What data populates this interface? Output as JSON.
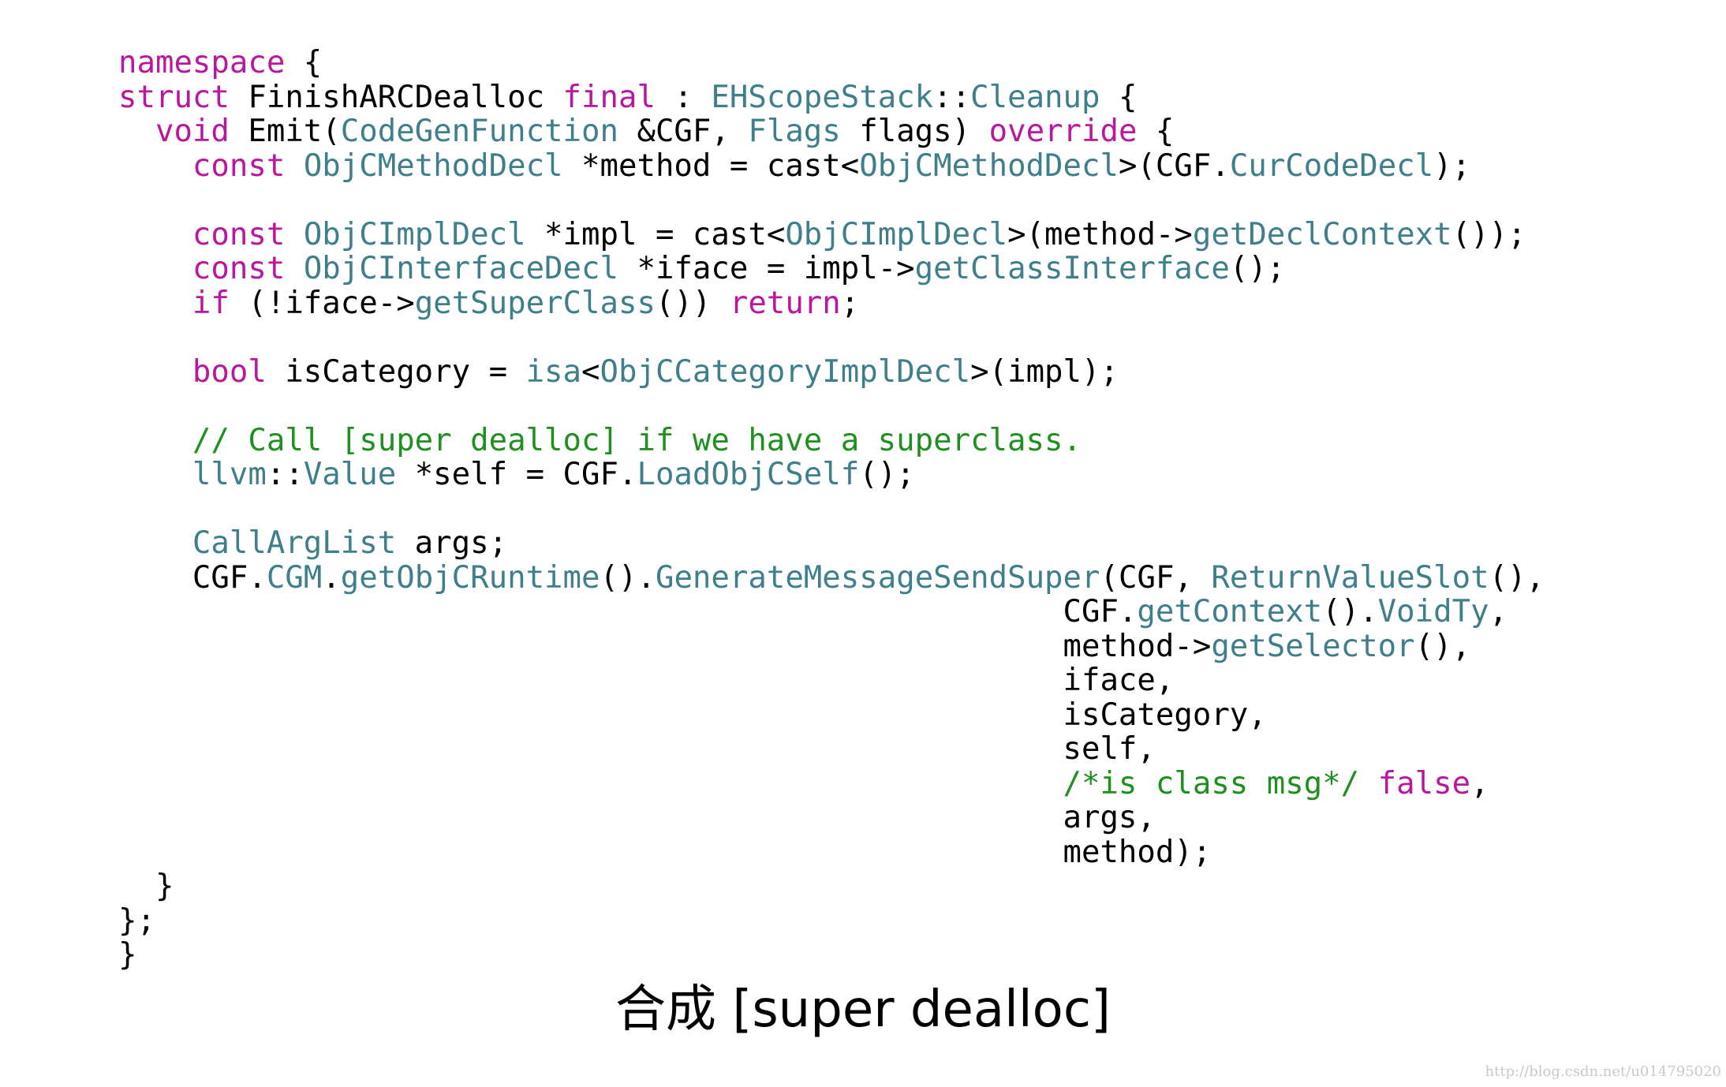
{
  "code_lines": [
    [
      {
        "t": "namespace",
        "c": "kw"
      },
      {
        "t": " {",
        "c": "pl"
      }
    ],
    [
      {
        "t": "struct",
        "c": "kw"
      },
      {
        "t": " FinishARCDealloc ",
        "c": "pl"
      },
      {
        "t": "final",
        "c": "kw"
      },
      {
        "t": " : ",
        "c": "pl"
      },
      {
        "t": "EHScopeStack",
        "c": "ty"
      },
      {
        "t": "::",
        "c": "pl"
      },
      {
        "t": "Cleanup",
        "c": "ty"
      },
      {
        "t": " {",
        "c": "pl"
      }
    ],
    [
      {
        "t": "  ",
        "c": "pl"
      },
      {
        "t": "void",
        "c": "kw"
      },
      {
        "t": " Emit(",
        "c": "pl"
      },
      {
        "t": "CodeGenFunction",
        "c": "ty"
      },
      {
        "t": " &CGF, ",
        "c": "pl"
      },
      {
        "t": "Flags",
        "c": "ty"
      },
      {
        "t": " flags) ",
        "c": "pl"
      },
      {
        "t": "override",
        "c": "kw"
      },
      {
        "t": " {",
        "c": "pl"
      }
    ],
    [
      {
        "t": "    ",
        "c": "pl"
      },
      {
        "t": "const",
        "c": "kw"
      },
      {
        "t": " ",
        "c": "pl"
      },
      {
        "t": "ObjCMethodDecl",
        "c": "ty"
      },
      {
        "t": " *method = cast<",
        "c": "pl"
      },
      {
        "t": "ObjCMethodDecl",
        "c": "ty"
      },
      {
        "t": ">(CGF.",
        "c": "pl"
      },
      {
        "t": "CurCodeDecl",
        "c": "fn"
      },
      {
        "t": ");",
        "c": "pl"
      }
    ],
    [],
    [
      {
        "t": "    ",
        "c": "pl"
      },
      {
        "t": "const",
        "c": "kw"
      },
      {
        "t": " ",
        "c": "pl"
      },
      {
        "t": "ObjCImplDecl",
        "c": "ty"
      },
      {
        "t": " *impl = cast<",
        "c": "pl"
      },
      {
        "t": "ObjCImplDecl",
        "c": "ty"
      },
      {
        "t": ">(method->",
        "c": "pl"
      },
      {
        "t": "getDeclContext",
        "c": "fn"
      },
      {
        "t": "());",
        "c": "pl"
      }
    ],
    [
      {
        "t": "    ",
        "c": "pl"
      },
      {
        "t": "const",
        "c": "kw"
      },
      {
        "t": " ",
        "c": "pl"
      },
      {
        "t": "ObjCInterfaceDecl",
        "c": "ty"
      },
      {
        "t": " *iface = impl->",
        "c": "pl"
      },
      {
        "t": "getClassInterface",
        "c": "fn"
      },
      {
        "t": "();",
        "c": "pl"
      }
    ],
    [
      {
        "t": "    ",
        "c": "pl"
      },
      {
        "t": "if",
        "c": "kw"
      },
      {
        "t": " (!iface->",
        "c": "pl"
      },
      {
        "t": "getSuperClass",
        "c": "fn"
      },
      {
        "t": "()) ",
        "c": "pl"
      },
      {
        "t": "return",
        "c": "kw"
      },
      {
        "t": ";",
        "c": "pl"
      }
    ],
    [],
    [
      {
        "t": "    ",
        "c": "pl"
      },
      {
        "t": "bool",
        "c": "kw"
      },
      {
        "t": " isCategory = ",
        "c": "pl"
      },
      {
        "t": "isa",
        "c": "fn"
      },
      {
        "t": "<",
        "c": "pl"
      },
      {
        "t": "ObjCCategoryImplDecl",
        "c": "ty"
      },
      {
        "t": ">(impl);",
        "c": "pl"
      }
    ],
    [],
    [
      {
        "t": "    ",
        "c": "pl"
      },
      {
        "t": "// Call [super dealloc] if we have a superclass.",
        "c": "cm"
      }
    ],
    [
      {
        "t": "    ",
        "c": "pl"
      },
      {
        "t": "llvm",
        "c": "ty"
      },
      {
        "t": "::",
        "c": "pl"
      },
      {
        "t": "Value",
        "c": "ty"
      },
      {
        "t": " *self = CGF.",
        "c": "pl"
      },
      {
        "t": "LoadObjCSelf",
        "c": "fn"
      },
      {
        "t": "();",
        "c": "pl"
      }
    ],
    [],
    [
      {
        "t": "    ",
        "c": "pl"
      },
      {
        "t": "CallArgList",
        "c": "ty"
      },
      {
        "t": " args;",
        "c": "pl"
      }
    ],
    [
      {
        "t": "    CGF.",
        "c": "pl"
      },
      {
        "t": "CGM",
        "c": "fn"
      },
      {
        "t": ".",
        "c": "pl"
      },
      {
        "t": "getObjCRuntime",
        "c": "fn"
      },
      {
        "t": "().",
        "c": "pl"
      },
      {
        "t": "GenerateMessageSendSuper",
        "c": "fn"
      },
      {
        "t": "(CGF, ",
        "c": "pl"
      },
      {
        "t": "ReturnValueSlot",
        "c": "ty"
      },
      {
        "t": "(),",
        "c": "pl"
      }
    ],
    [
      {
        "t": "                                                   CGF.",
        "c": "pl"
      },
      {
        "t": "getContext",
        "c": "fn"
      },
      {
        "t": "().",
        "c": "pl"
      },
      {
        "t": "VoidTy",
        "c": "fn"
      },
      {
        "t": ",",
        "c": "pl"
      }
    ],
    [
      {
        "t": "                                                   method->",
        "c": "pl"
      },
      {
        "t": "getSelector",
        "c": "fn"
      },
      {
        "t": "(),",
        "c": "pl"
      }
    ],
    [
      {
        "t": "                                                   iface,",
        "c": "pl"
      }
    ],
    [
      {
        "t": "                                                   isCategory,",
        "c": "pl"
      }
    ],
    [
      {
        "t": "                                                   self,",
        "c": "pl"
      }
    ],
    [
      {
        "t": "                                                   ",
        "c": "pl"
      },
      {
        "t": "/*is class msg*/",
        "c": "cm"
      },
      {
        "t": " ",
        "c": "pl"
      },
      {
        "t": "false",
        "c": "kw"
      },
      {
        "t": ",",
        "c": "pl"
      }
    ],
    [
      {
        "t": "                                                   args,",
        "c": "pl"
      }
    ],
    [
      {
        "t": "                                                   method);",
        "c": "pl"
      }
    ],
    [
      {
        "t": "  }",
        "c": "pl"
      }
    ],
    [
      {
        "t": "};",
        "c": "pl"
      }
    ],
    [
      {
        "t": "}",
        "c": "pl"
      }
    ]
  ],
  "caption": "合成 [super dealloc]",
  "watermark": "http://blog.csdn.net/u014795020",
  "colors": {
    "keyword": "#b8179e",
    "type": "#3f7f8c",
    "comment": "#1f8f1f",
    "plain": "#000000",
    "background": "#ffffff"
  }
}
